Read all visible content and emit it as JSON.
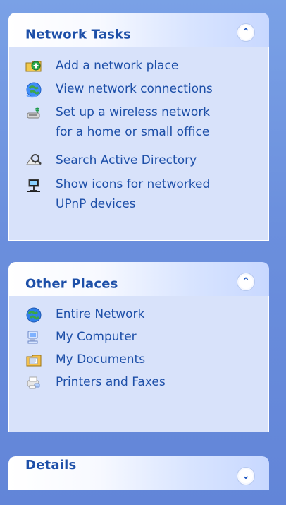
{
  "window": {
    "colors": {
      "background": "#6f94df",
      "panel_body": "#d8e2fa",
      "panel_border": "#ffffff",
      "header_text": "#1d4fa8",
      "link_text": "#1d4fa8"
    }
  },
  "panels": {
    "network_tasks": {
      "title": "Network Tasks",
      "collapse_icon": "chevron-up-double-icon",
      "items": [
        {
          "label": "Add a network place",
          "icon": "add-network-place-icon"
        },
        {
          "label": "View network connections",
          "icon": "network-connections-icon"
        },
        {
          "label": "Set up a wireless network\nfor a home or small office",
          "icon": "wireless-network-icon"
        },
        {
          "label": "Search Active Directory",
          "icon": "search-directory-icon"
        },
        {
          "label": "Show icons for networked\nUPnP devices",
          "icon": "upnp-devices-icon"
        }
      ]
    },
    "other_places": {
      "title": "Other Places",
      "collapse_icon": "chevron-up-double-icon",
      "items": [
        {
          "label": "Entire Network",
          "icon": "globe-icon"
        },
        {
          "label": "My Computer",
          "icon": "computer-icon"
        },
        {
          "label": "My Documents",
          "icon": "documents-icon"
        },
        {
          "label": "Printers and Faxes",
          "icon": "printer-fax-icon"
        }
      ]
    },
    "details": {
      "title": "Details",
      "expand_icon": "chevron-down-double-icon"
    }
  }
}
